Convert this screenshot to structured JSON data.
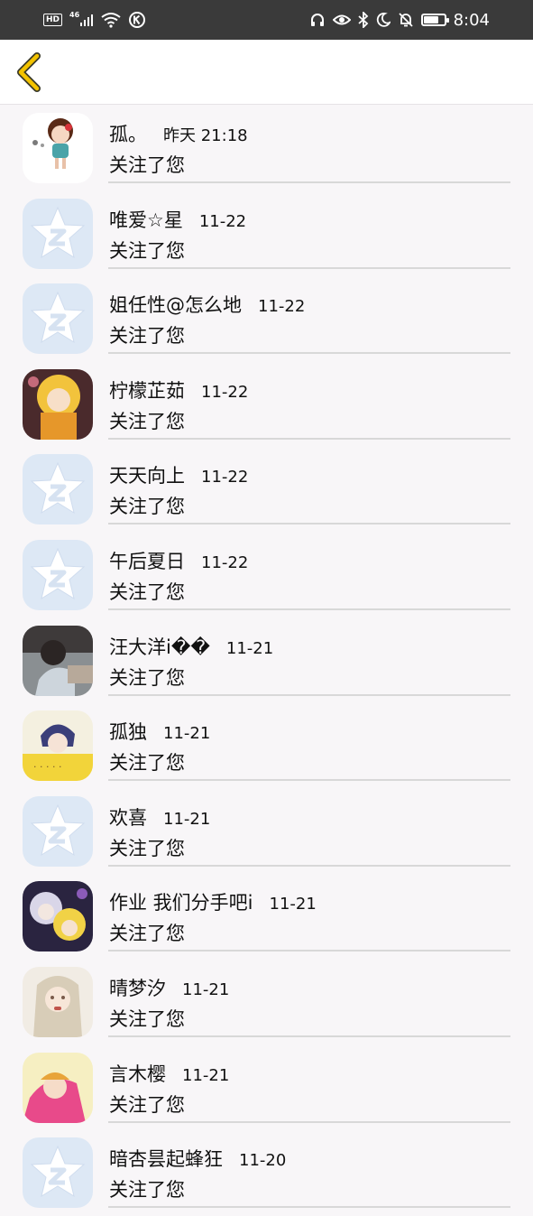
{
  "status_bar": {
    "hd": "HD",
    "network": "46",
    "time": "8:04"
  },
  "header": {
    "back_icon": "chevron-left-icon",
    "accent": "#f3c300"
  },
  "colors": {
    "default_avatar_bg": "#dde8f5",
    "default_avatar_fg": "#ffffff"
  },
  "notifications": [
    {
      "name": "孤。",
      "time": "昨天 21:18",
      "action": "关注了您",
      "avatar": "cartoon-girl-avatar"
    },
    {
      "name": "唯爱☆星",
      "time": "11-22",
      "action": "关注了您",
      "avatar": "default-avatar"
    },
    {
      "name": "姐任性@怎么地",
      "time": "11-22",
      "action": "关注了您",
      "avatar": "default-avatar"
    },
    {
      "name": "柠檬芷茹",
      "time": "11-22",
      "action": "关注了您",
      "avatar": "anime-blonde-avatar"
    },
    {
      "name": "天天向上",
      "time": "11-22",
      "action": "关注了您",
      "avatar": "default-avatar"
    },
    {
      "name": "午后夏日",
      "time": "11-22",
      "action": "关注了您",
      "avatar": "default-avatar"
    },
    {
      "name": "汪大洋i��",
      "time": "11-21",
      "action": "关注了您",
      "avatar": "photo-avatar"
    },
    {
      "name": "孤独",
      "time": "11-21",
      "action": "关注了您",
      "avatar": "anime-boy-avatar"
    },
    {
      "name": "欢喜",
      "time": "11-21",
      "action": "关注了您",
      "avatar": "default-avatar"
    },
    {
      "name": "作业 我们分手吧i",
      "time": "11-21",
      "action": "关注了您",
      "avatar": "anime-purple-avatar"
    },
    {
      "name": "晴梦汐",
      "time": "11-21",
      "action": "关注了您",
      "avatar": "anime-white-avatar"
    },
    {
      "name": "言木樱",
      "time": "11-21",
      "action": "关注了您",
      "avatar": "anime-pink-avatar"
    },
    {
      "name": "暗杏昙起蜂狂",
      "time": "11-20",
      "action": "关注了您",
      "avatar": "default-avatar"
    }
  ]
}
